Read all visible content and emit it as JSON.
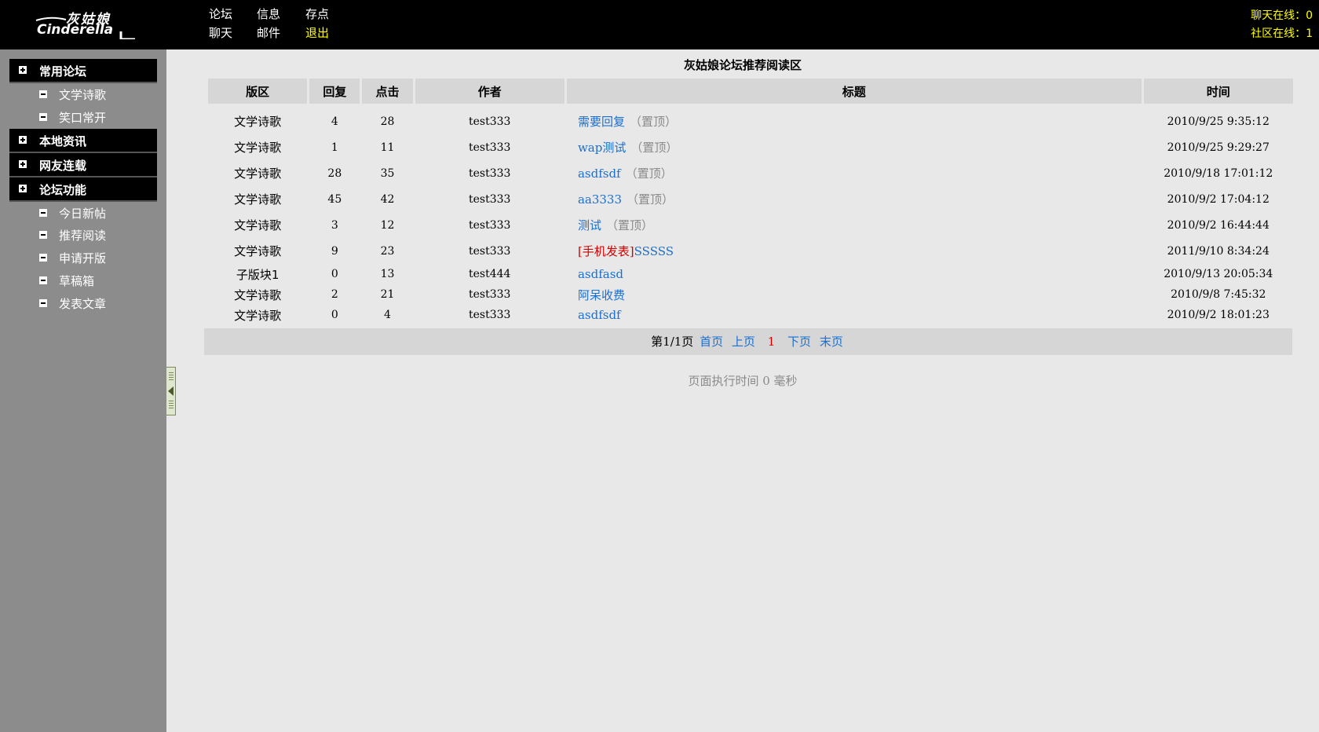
{
  "logo": {
    "text_cn": "灰姑娘",
    "text_en": "Cinderella"
  },
  "topnav": {
    "forum": "论坛",
    "info": "信息",
    "save": "存点",
    "chat": "聊天",
    "mail": "邮件",
    "exit": "退出"
  },
  "online": {
    "chat": "聊天在线：0",
    "community": "社区在线：1"
  },
  "sidebar": {
    "groups": [
      {
        "label": "常用论坛",
        "items": [
          "文学诗歌",
          "笑口常开"
        ]
      },
      {
        "label": "本地资讯",
        "items": []
      },
      {
        "label": "网友连载",
        "items": []
      },
      {
        "label": "论坛功能",
        "items": [
          "今日新帖",
          "推荐阅读",
          "申请开版",
          "草稿箱",
          "发表文章"
        ]
      }
    ]
  },
  "main": {
    "title": "灰姑娘论坛推荐阅读区",
    "columns": [
      "版区",
      "回复",
      "点击",
      "作者",
      "标题",
      "时间"
    ],
    "rows": [
      {
        "board": "文学诗歌",
        "replies": "4",
        "clicks": "28",
        "author": "test333",
        "title": "需要回复",
        "tag": "（置顶）",
        "time": "2010/9/25 9:35:12"
      },
      {
        "board": "文学诗歌",
        "replies": "1",
        "clicks": "11",
        "author": "test333",
        "title": "wap测试",
        "tag": "（置顶）",
        "time": "2010/9/25 9:29:27"
      },
      {
        "board": "文学诗歌",
        "replies": "28",
        "clicks": "35",
        "author": "test333",
        "title": "asdfsdf",
        "tag": "（置顶）",
        "time": "2010/9/18 17:01:12"
      },
      {
        "board": "文学诗歌",
        "replies": "45",
        "clicks": "42",
        "author": "test333",
        "title": "aa3333",
        "tag": "（置顶）",
        "time": "2010/9/2 17:04:12"
      },
      {
        "board": "文学诗歌",
        "replies": "3",
        "clicks": "12",
        "author": "test333",
        "title": "测试",
        "tag": "（置顶）",
        "time": "2010/9/2 16:44:44"
      },
      {
        "board": "文学诗歌",
        "replies": "9",
        "clicks": "23",
        "author": "test333",
        "mobile": "[手机发表]",
        "title": "SSSSS",
        "time": "2011/9/10 8:34:24"
      },
      {
        "board": "子版块1",
        "replies": "0",
        "clicks": "13",
        "author": "test444",
        "title": "asdfasd",
        "time": "2010/9/13 20:05:34"
      },
      {
        "board": "文学诗歌",
        "replies": "2",
        "clicks": "21",
        "author": "test333",
        "title": "阿呆收费",
        "time": "2010/9/8 7:45:32"
      },
      {
        "board": "文学诗歌",
        "replies": "0",
        "clicks": "4",
        "author": "test333",
        "title": "asdfsdf",
        "time": "2010/9/2 18:01:23"
      }
    ],
    "pager": {
      "info": "第1/1页",
      "first": "首页",
      "prev": "上页",
      "current": "1",
      "next": "下页",
      "last": "末页"
    },
    "exec_time": "页面执行时间 0 毫秒"
  }
}
